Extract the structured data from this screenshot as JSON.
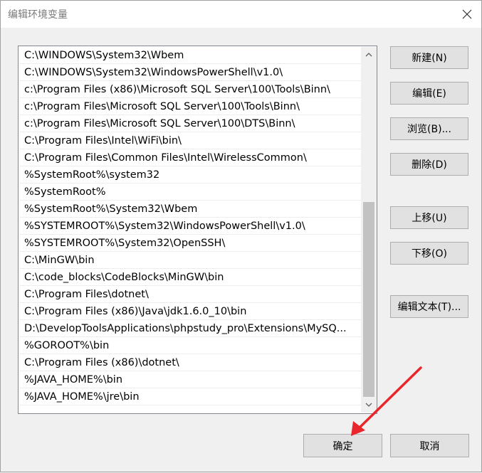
{
  "window": {
    "title": "编辑环境变量"
  },
  "paths": [
    "C:\\WINDOWS\\System32\\Wbem",
    "C:\\WINDOWS\\System32\\WindowsPowerShell\\v1.0\\",
    "c:\\Program Files (x86)\\Microsoft SQL Server\\100\\Tools\\Binn\\",
    "c:\\Program Files\\Microsoft SQL Server\\100\\Tools\\Binn\\",
    "c:\\Program Files\\Microsoft SQL Server\\100\\DTS\\Binn\\",
    "C:\\Program Files\\Intel\\WiFi\\bin\\",
    "C:\\Program Files\\Common Files\\Intel\\WirelessCommon\\",
    "%SystemRoot%\\system32",
    "%SystemRoot%",
    "%SystemRoot%\\System32\\Wbem",
    "%SYSTEMROOT%\\System32\\WindowsPowerShell\\v1.0\\",
    "%SYSTEMROOT%\\System32\\OpenSSH\\",
    "C:\\MinGW\\bin",
    "C:\\code_blocks\\CodeBlocks\\MinGW\\bin",
    "C:\\Program Files\\dotnet\\",
    "C:\\Program Files (x86)\\Java\\jdk1.6.0_10\\bin",
    "D:\\DevelopToolsApplications\\phpstudy_pro\\Extensions\\MySQ...",
    "%GOROOT%\\bin",
    "C:\\Program Files (x86)\\dotnet\\",
    "%JAVA_HOME%\\bin",
    "%JAVA_HOME%\\jre\\bin"
  ],
  "buttons": {
    "new": "新建(N)",
    "edit": "编辑(E)",
    "browse": "浏览(B)...",
    "delete": "删除(D)",
    "move_up": "上移(U)",
    "move_down": "下移(O)",
    "edit_text": "编辑文本(T)...",
    "ok": "确定",
    "cancel": "取消"
  },
  "colors": {
    "annotation_arrow": "#e8262b"
  }
}
